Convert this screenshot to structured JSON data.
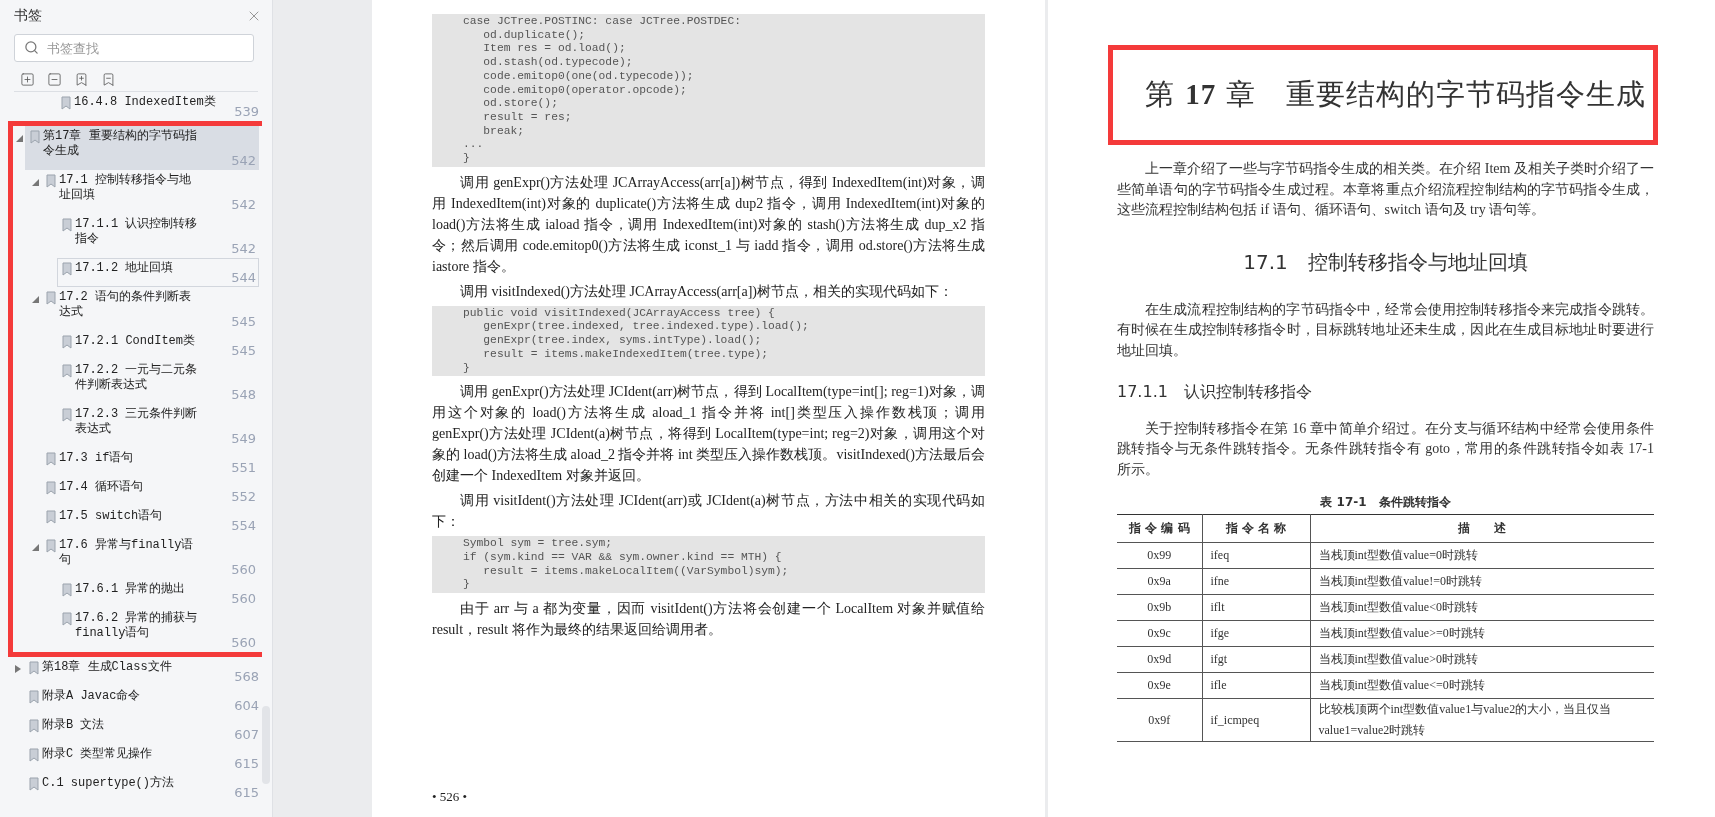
{
  "sidebar": {
    "title": "书签",
    "search": {
      "placeholder": "书签查找"
    },
    "partial_item": {
      "label": "16.4.8 IndexedItem类",
      "page": "539"
    },
    "items": [
      {
        "label": "第17章 重要结构的字节码指令生成",
        "page": "542",
        "expanded": true,
        "selected": true,
        "focused": false,
        "highlighted": true,
        "children": [
          {
            "label": "17.1 控制转移指令与地址回填",
            "page": "542",
            "expanded": true,
            "selected": false,
            "focused": false,
            "children": [
              {
                "label": "17.1.1 认识控制转移指令",
                "page": "542",
                "selected": false,
                "focused": false
              },
              {
                "label": "17.1.2 地址回填",
                "page": "544",
                "selected": false,
                "focused": true
              }
            ]
          },
          {
            "label": "17.2 语句的条件判断表达式",
            "page": "545",
            "expanded": true,
            "selected": false,
            "focused": false,
            "children": [
              {
                "label": "17.2.1 CondItem类",
                "page": "545",
                "selected": false,
                "focused": false
              },
              {
                "label": "17.2.2 一元与二元条件判断表达式",
                "page": "548",
                "selected": false,
                "focused": false
              },
              {
                "label": "17.2.3 三元条件判断表达式",
                "page": "549",
                "selected": false,
                "focused": false
              }
            ]
          },
          {
            "label": "17.3 if语句",
            "page": "551",
            "selected": false,
            "focused": false
          },
          {
            "label": "17.4 循环语句",
            "page": "552",
            "selected": false,
            "focused": false
          },
          {
            "label": "17.5 switch语句",
            "page": "554",
            "selected": false,
            "focused": false
          },
          {
            "label": "17.6 异常与finally语句",
            "page": "560",
            "expanded": true,
            "selected": false,
            "focused": false,
            "children": [
              {
                "label": "17.6.1 异常的抛出",
                "page": "560",
                "selected": false,
                "focused": false
              },
              {
                "label": "17.6.2 异常的捕获与finally语句",
                "page": "560",
                "selected": false,
                "focused": false
              }
            ]
          }
        ]
      },
      {
        "label": "第18章 生成Class文件",
        "page": "568",
        "expanded": false,
        "selected": false,
        "focused": false,
        "highlighted": false
      },
      {
        "label": "附录A Javac命令",
        "page": "604",
        "selected": false,
        "focused": false,
        "highlighted": false
      },
      {
        "label": "附录B 文法",
        "page": "607",
        "selected": false,
        "focused": false,
        "highlighted": false
      },
      {
        "label": "附录C 类型常见操作",
        "page": "615",
        "selected": false,
        "focused": false,
        "highlighted": false
      },
      {
        "label": "C.1 supertype()方法",
        "page": "615",
        "selected": false,
        "focused": false,
        "highlighted": false
      }
    ]
  },
  "left_page": {
    "blocks": [
      {
        "kind": "code",
        "lines": [
          "case JCTree.POSTINC: case JCTree.POSTDEC:",
          "   od.duplicate();",
          "   Item res = od.load();",
          "   od.stash(od.typecode);",
          "   code.emitop0(one(od.typecode));",
          "   code.emitop0(operator.opcode);",
          "   od.store();",
          "   result = res;",
          "   break;",
          "...",
          "}"
        ]
      },
      {
        "kind": "paragraph",
        "text": "调用 genExpr()方法处理 JCArrayAccess(arr[a])树节点，得到 IndexedItem(int)对象，调用 IndexedItem(int)对象的 duplicate()方法将生成 dup2 指令，调用 IndexedItem(int)对象的 load()方法将生成 iaload 指令，调用 IndexedItem(int)对象的 stash()方法将生成 dup_x2 指令；然后调用 code.emitop0()方法将生成 iconst_1 与 iadd 指令，调用 od.store()方法将生成 iastore 指令。"
      },
      {
        "kind": "paragraph",
        "text": "调用 visitIndexed()方法处理 JCArrayAccess(arr[a])树节点，相关的实现代码如下："
      },
      {
        "kind": "code",
        "lines": [
          "public void visitIndexed(JCArrayAccess tree) {",
          "   genExpr(tree.indexed, tree.indexed.type).load();",
          "   genExpr(tree.index, syms.intType).load();",
          "   result = items.makeIndexedItem(tree.type);",
          "}"
        ]
      },
      {
        "kind": "paragraph",
        "text": "调用 genExpr()方法处理 JCIdent(arr)树节点，得到 LocalItem(type=int[]; reg=1)对象，调用这个对象的 load()方法将生成 aload_1 指令并将 int[]类型压入操作数栈顶；调用 genExpr()方法处理 JCIdent(a)树节点，将得到 LocalItem(type=int; reg=2)对象，调用这个对象的 load()方法将生成 aload_2 指令并将 int 类型压入操作数栈顶。visitIndexed()方法最后会创建一个 IndexedItem 对象并返回。"
      },
      {
        "kind": "paragraph",
        "text": "调用 visitIdent()方法处理 JCIdent(arr)或 JCIdent(a)树节点，方法中相关的实现代码如下："
      },
      {
        "kind": "code",
        "lines": [
          "Symbol sym = tree.sym;",
          "if (sym.kind == VAR && sym.owner.kind == MTH) {",
          "   result = items.makeLocalItem((VarSymbol)sym);",
          "}"
        ]
      },
      {
        "kind": "paragraph",
        "text": "由于 arr 与 a 都为变量，因而 visitIdent()方法将会创建一个 LocalItem 对象并赋值给 result，result 将作为最终的结果返回给调用者。"
      }
    ],
    "page_number": "• 526 •"
  },
  "right_page": {
    "chapter_title": "第 **17** 章　重要结构的字节码指令生成",
    "chapter_highlighted": true,
    "blocks": [
      {
        "kind": "paragraph",
        "text": "上一章介绍了一些与字节码指令生成的相关类。在介绍 Item 及相关子类时介绍了一些简单语句的字节码指令生成过程。本章将重点介绍流程控制结构的字节码指令生成，这些流程控制结构包括 if 语句、循环语句、switch 语句及 try 语句等。"
      },
      {
        "kind": "section_heading",
        "text": "17.1　控制转移指令与地址回填"
      },
      {
        "kind": "paragraph",
        "text": "在生成流程控制结构的字节码指令中，经常会使用控制转移指令来完成指令跳转。有时候在生成控制转移指令时，目标跳转地址还未生成，因此在生成目标地址时要进行地址回填。"
      },
      {
        "kind": "subsection_heading",
        "text": "17.1.1　认识控制转移指令"
      },
      {
        "kind": "paragraph",
        "text": "关于控制转移指令在第 16 章中简单介绍过。在分支与循环结构中经常会使用条件跳转指令与无条件跳转指令。无条件跳转指令有 goto，常用的条件跳转指令如表 17-1 所示。"
      },
      {
        "kind": "table",
        "caption": "表 17-1　条件跳转指令",
        "columns": [
          "指 令 编 码",
          "指 令 名 称",
          "描　　述"
        ],
        "rows": [
          [
            "0x99",
            "ifeq",
            "当栈顶int型数值value=0时跳转"
          ],
          [
            "0x9a",
            "ifne",
            "当栈顶int型数值value!=0时跳转"
          ],
          [
            "0x9b",
            "iflt",
            "当栈顶int型数值value<0时跳转"
          ],
          [
            "0x9c",
            "ifge",
            "当栈顶int型数值value>=0时跳转"
          ],
          [
            "0x9d",
            "ifgt",
            "当栈顶int型数值value>0时跳转"
          ],
          [
            "0x9e",
            "ifle",
            "当栈顶int型数值value<=0时跳转"
          ],
          [
            "0x9f",
            "if_icmpeq",
            "比较栈顶两个int型数值value1与value2的大小，当且仅当value1=value2时跳转"
          ]
        ]
      }
    ]
  }
}
